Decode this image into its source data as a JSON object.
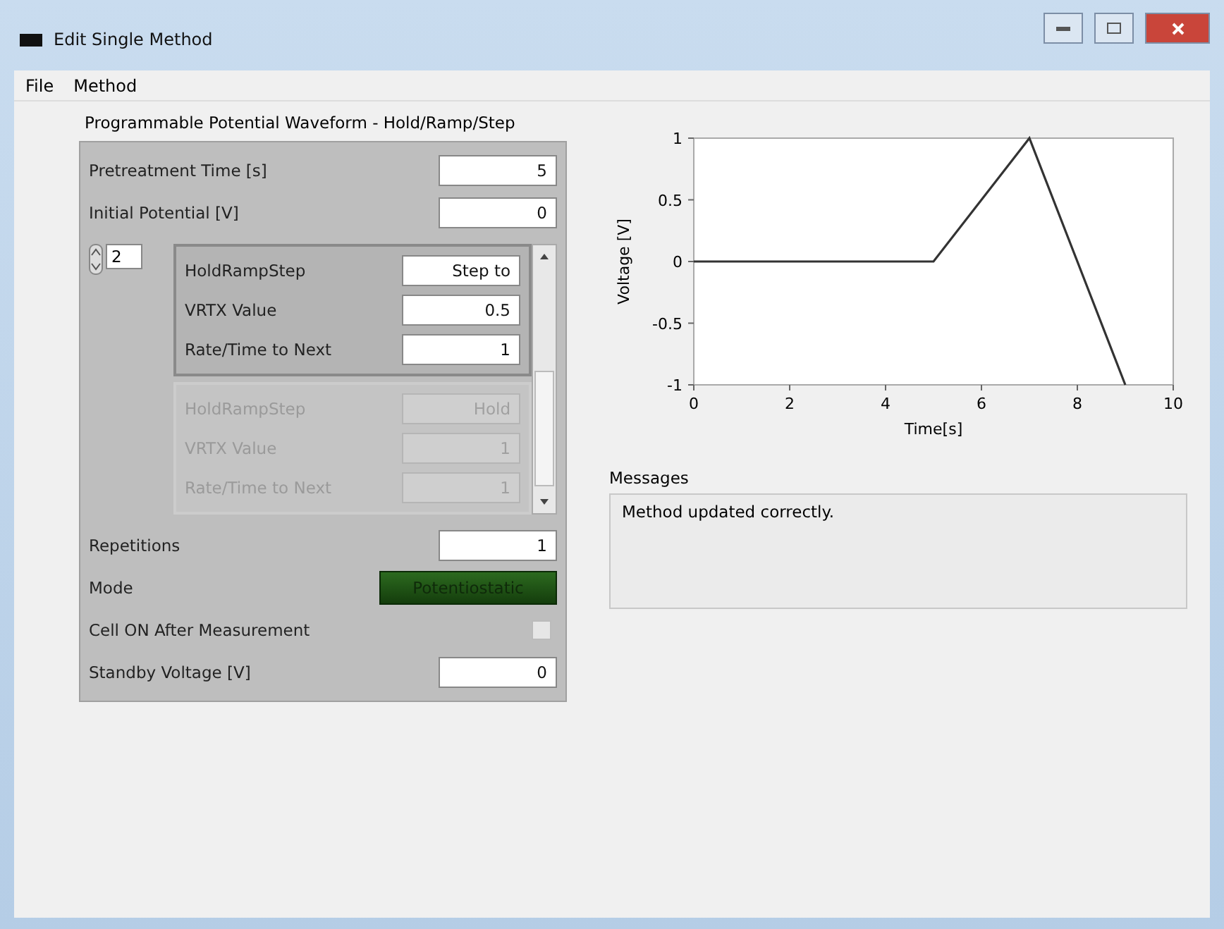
{
  "window": {
    "title": "Edit Single Method"
  },
  "menu": [
    "File",
    "Method"
  ],
  "section_title": "Programmable Potential Waveform - Hold/Ramp/Step",
  "top_fields": [
    {
      "label": "Pretreatment Time [s]",
      "value": "5"
    },
    {
      "label": "Initial Potential [V]",
      "value": "0"
    }
  ],
  "step_index": "2",
  "steps": [
    {
      "disabled": false,
      "fields": [
        {
          "label": "HoldRampStep",
          "value": "Step to"
        },
        {
          "label": "VRTX Value",
          "value": "0.5"
        },
        {
          "label": "Rate/Time to Next",
          "value": "1"
        }
      ]
    },
    {
      "disabled": true,
      "fields": [
        {
          "label": "HoldRampStep",
          "value": "Hold"
        },
        {
          "label": "VRTX Value",
          "value": "1"
        },
        {
          "label": "Rate/Time to Next",
          "value": "1"
        }
      ]
    }
  ],
  "bottom_fields": [
    {
      "kind": "number",
      "label": "Repetitions",
      "value": "1"
    },
    {
      "kind": "button",
      "label": "Mode",
      "value": "Potentiostatic"
    },
    {
      "kind": "checkbox",
      "label": "Cell ON After Measurement",
      "checked": false
    },
    {
      "kind": "number",
      "label": "Standby Voltage [V]",
      "value": "0"
    }
  ],
  "graph": {
    "chart_data": {
      "type": "line",
      "xlabel": "Time[s]",
      "ylabel": "Voltage [V]",
      "x": [
        0,
        5,
        7,
        9
      ],
      "series": [
        {
          "color": "#333333",
          "values": [
            0,
            0,
            1,
            -1
          ]
        }
      ],
      "xlim": [
        0,
        10
      ],
      "ylim": [
        -1,
        1
      ],
      "xticks": [
        0,
        2,
        4,
        6,
        8,
        10
      ],
      "yticks": [
        -1,
        -0.5,
        0,
        0.5,
        1
      ]
    }
  },
  "messages": {
    "label": "Messages",
    "text": "Method updated correctly."
  }
}
